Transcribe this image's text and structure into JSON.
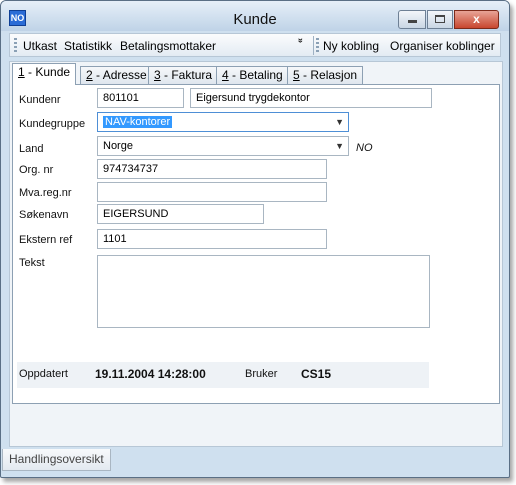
{
  "window": {
    "title": "Kunde",
    "app_icon_label": "NO",
    "close_glyph": "x"
  },
  "toolbar": {
    "items": [
      "Utkast",
      "Statistikk",
      "Betalingsmottaker"
    ],
    "overflow_glyph": "»",
    "right_items": [
      "Ny kobling",
      "Organiser koblinger"
    ]
  },
  "tabs": [
    {
      "key": "1",
      "label": " - Kunde"
    },
    {
      "key": "2",
      "label": " - Adresse"
    },
    {
      "key": "3",
      "label": " - Faktura"
    },
    {
      "key": "4",
      "label": " - Betaling"
    },
    {
      "key": "5",
      "label": " - Relasjon"
    }
  ],
  "form": {
    "kundenr": {
      "label": "Kundenr",
      "value": "801101",
      "name_value": "Eigersund trygdekontor"
    },
    "kundegruppe": {
      "label": "Kundegruppe",
      "value": "NAV-kontorer"
    },
    "land": {
      "label": "Land",
      "value": "Norge",
      "code": "NO"
    },
    "orgnr": {
      "label": "Org. nr",
      "value": "974734737"
    },
    "mvaregnr": {
      "label": "Mva.reg.nr",
      "value": ""
    },
    "sokenavn": {
      "label": "Søkenavn",
      "value": "EIGERSUND"
    },
    "eksternref": {
      "label": "Ekstern ref",
      "value": "1101"
    },
    "tekst": {
      "label": "Tekst",
      "value": ""
    }
  },
  "status": {
    "updated_label": "Oppdatert",
    "updated_value": "19.11.2004 14:28:00",
    "user_label": "Bruker",
    "user_value": "CS15"
  },
  "bottom_tab": {
    "label": "Handlingsoversikt"
  }
}
